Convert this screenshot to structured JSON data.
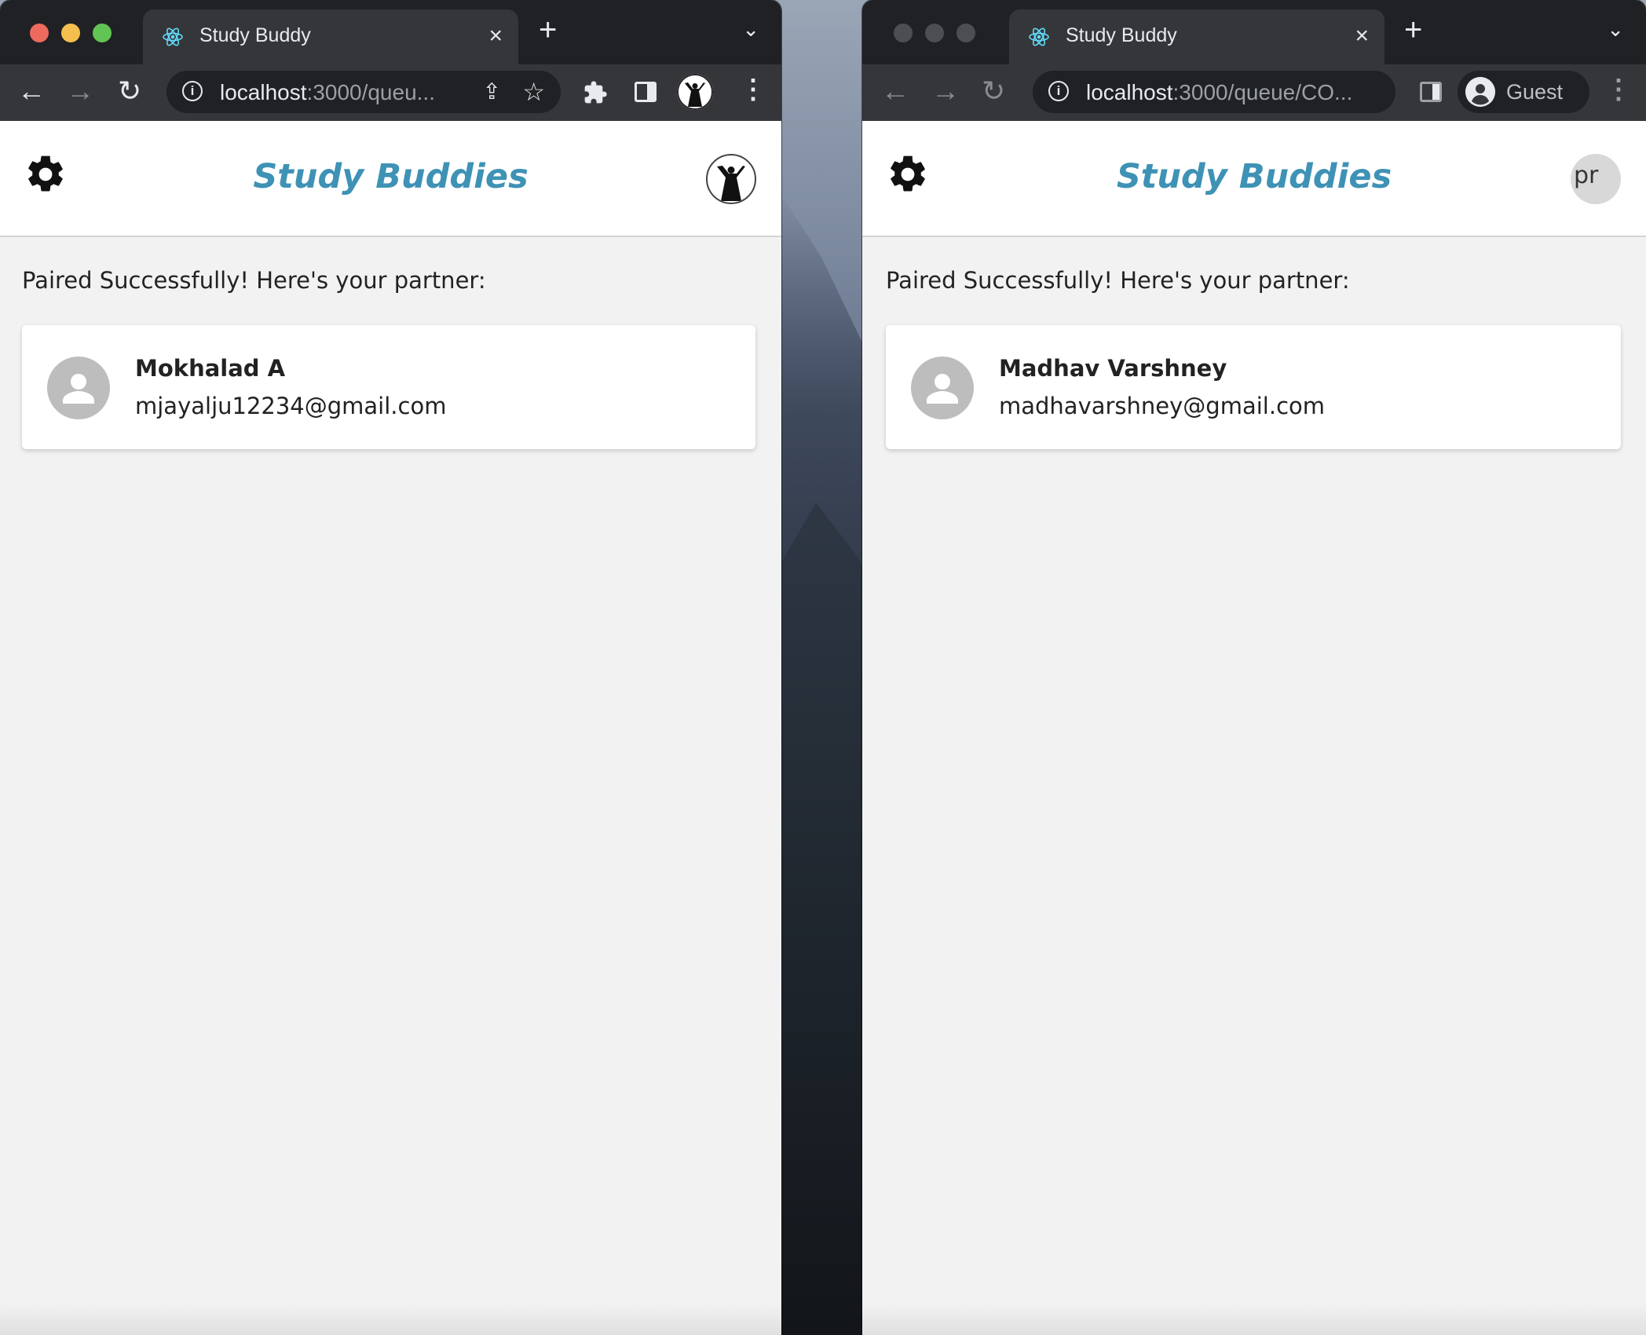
{
  "colors": {
    "brand": "#3e92b5",
    "chrome_dark": "#202124",
    "chrome_tab": "#35363a",
    "traffic_red": "#ed6a5e",
    "traffic_yellow": "#f5bf4f",
    "traffic_green": "#61c554",
    "traffic_inactive": "#4d4e52"
  },
  "left_window": {
    "tab": {
      "title": "Study Buddy",
      "favicon": "react-logo-icon",
      "close": "×"
    },
    "new_tab": "+",
    "tab_menu": "⌄",
    "nav": {
      "back": "←",
      "forward": "→",
      "reload": "↻"
    },
    "url": {
      "host": "localhost",
      "path": ":3000/queu..."
    },
    "icons": {
      "share": "⇪",
      "star": "☆",
      "extensions": "puzzle-icon",
      "menu": "⋮"
    },
    "app": {
      "brand": "Study Buddies",
      "status": "Paired Successfully! Here's your partner:",
      "partner": {
        "name": "Mokhalad A",
        "email": "mjayalju12234@gmail.com"
      }
    }
  },
  "right_window": {
    "tab": {
      "title": "Study Buddy",
      "favicon": "react-logo-icon",
      "close": "×"
    },
    "new_tab": "+",
    "tab_menu": "⌄",
    "nav": {
      "back": "←",
      "forward": "→",
      "reload": "↻"
    },
    "url": {
      "host": "localhost",
      "path": ":3000/queue/CO..."
    },
    "profile": {
      "label": "Guest"
    },
    "icons": {
      "menu": "⋮"
    },
    "app": {
      "brand": "Study Buddies",
      "avatar_alt": "pr",
      "status": "Paired Successfully! Here's your partner:",
      "partner": {
        "name": "Madhav Varshney",
        "email": "madhavarshney@gmail.com"
      }
    }
  }
}
